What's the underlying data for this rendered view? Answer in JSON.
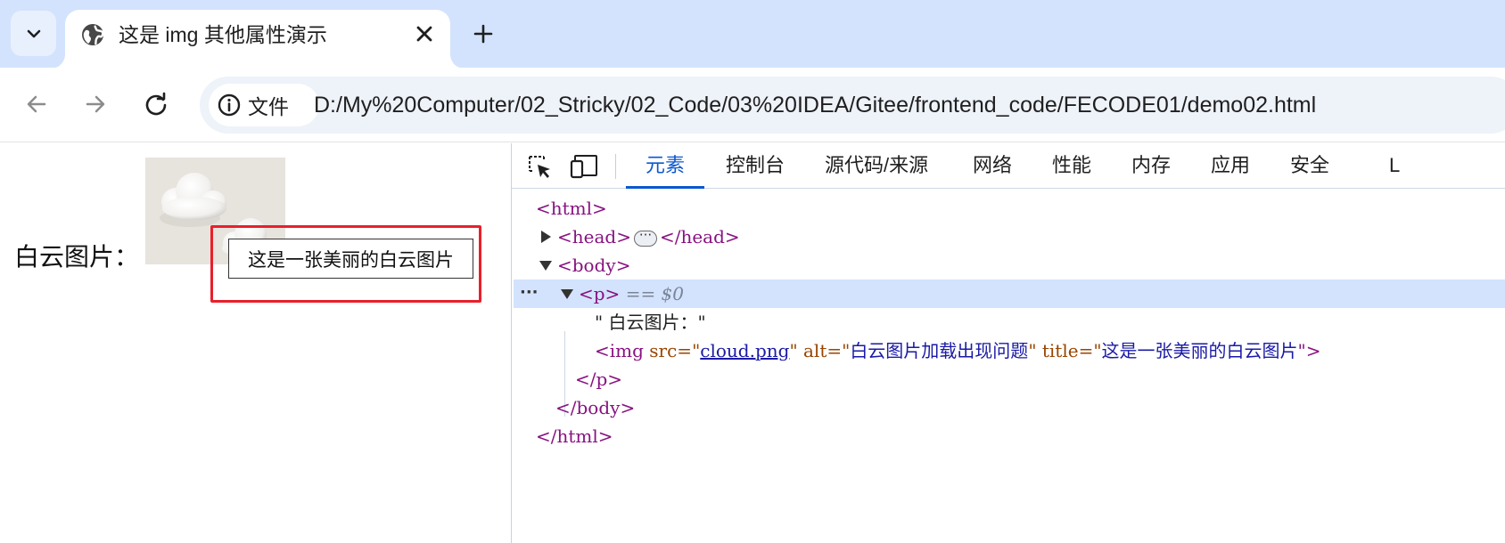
{
  "browser": {
    "tab": {
      "title": "这是 img 其他属性演示",
      "favicon": "globe-icon",
      "close": "✕"
    },
    "toolbar": {
      "chip_label": "文件",
      "url": "D:/My%20Computer/02_Stricky/02_Code/03%20IDEA/Gitee/frontend_code/FECODE01/demo02.html"
    }
  },
  "page": {
    "paragraph_text": "白云图片：",
    "image_alt": "白云图片加载出现问题",
    "tooltip": "这是一张美丽的白云图片",
    "highlight_color": "#e8202a"
  },
  "devtools": {
    "tabs": [
      "元素",
      "控制台",
      "源代码/来源",
      "网络",
      "性能",
      "内存",
      "应用",
      "安全",
      "L"
    ],
    "active_tab": "元素",
    "dom": {
      "html_open": "<html>",
      "head_open": "<head>",
      "head_close": "</head>",
      "body_open": "<body>",
      "p_open": "<p>",
      "p_eq": "== $0",
      "text_node": "\" 白云图片：\"",
      "img_open": "<img ",
      "img_src_name": "src=\"",
      "img_src_val": "cloud.png",
      "img_alt_name": "\" alt=\"",
      "img_alt_val": "白云图片加载出现问题",
      "img_title_name": "\" title=\"",
      "img_title_val": "这是一张美丽的白云图片",
      "img_close": "\">",
      "p_close": "</p>",
      "body_close": "</body>",
      "html_close": "</html>"
    }
  },
  "colors": {
    "tabstrip_bg": "#d3e3fd",
    "accent": "#0b57d0",
    "tag": "#881280",
    "attr_name": "#994500",
    "attr_value": "#1a1aa6"
  }
}
